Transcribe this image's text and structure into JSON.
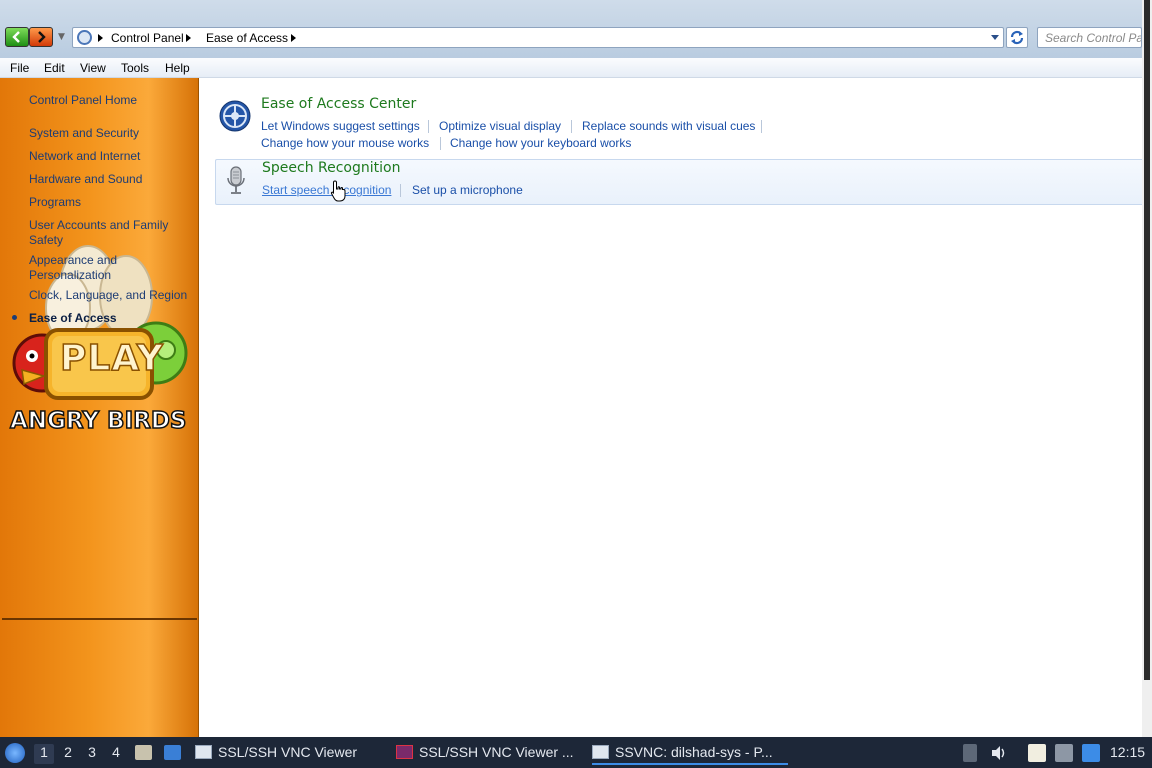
{
  "address_bar": {
    "crumbs": [
      "Control Panel",
      "Ease of Access"
    ],
    "search_placeholder": "Search Control Pa"
  },
  "menubar": {
    "items": [
      "File",
      "Edit",
      "View",
      "Tools",
      "Help"
    ]
  },
  "sidebar": {
    "items": [
      "Control Panel Home",
      "System and Security",
      "Network and Internet",
      "Hardware and Sound",
      "Programs",
      "User Accounts and Family Safety",
      "Appearance and Personalization",
      "Clock, Language, and Region",
      "Ease of Access"
    ],
    "active_index": 8,
    "ad_text_1": "PLAY",
    "ad_text_2": "ANGRY BIRDS"
  },
  "categories": [
    {
      "title": "Ease of Access Center",
      "links": [
        "Let Windows suggest settings",
        "Optimize visual display",
        "Replace sounds with visual cues",
        "Change how your mouse works",
        "Change how your keyboard works"
      ]
    },
    {
      "title": "Speech Recognition",
      "links": [
        "Start speech recognition",
        "Set up a microphone"
      ]
    }
  ],
  "taskbar": {
    "workspaces": [
      "1",
      "2",
      "3",
      "4"
    ],
    "active_workspace": 0,
    "tasks": [
      "SSL/SSH VNC Viewer",
      "SSL/SSH VNC Viewer ...",
      "SSVNC: dilshad-sys - P..."
    ],
    "active_task": 2,
    "clock": "12:15"
  },
  "colors": {
    "sidebar_orange": "#f3941c",
    "link_blue": "#1a4fa8",
    "title_green": "#1e7a1e",
    "taskbar_bg": "#1d2738"
  }
}
